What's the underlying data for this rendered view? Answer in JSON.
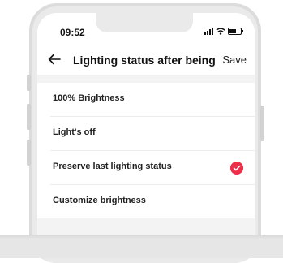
{
  "status_bar": {
    "time": "09:52",
    "signal_icon": "signal-bars-icon",
    "wifi_icon": "wifi-icon",
    "battery_icon": "battery-icon",
    "battery_level": 0.6
  },
  "header": {
    "back_icon": "back-arrow-icon",
    "title": "Lighting status after being po...",
    "save_label": "Save"
  },
  "options": [
    {
      "label": "100% Brightness",
      "selected": false
    },
    {
      "label": "Light's off",
      "selected": false
    },
    {
      "label": "Preserve last lighting status",
      "selected": true
    },
    {
      "label": "Customize brightness",
      "selected": false
    }
  ],
  "colors": {
    "accent": "#ee2f4a",
    "background": "#f3f3f3"
  }
}
